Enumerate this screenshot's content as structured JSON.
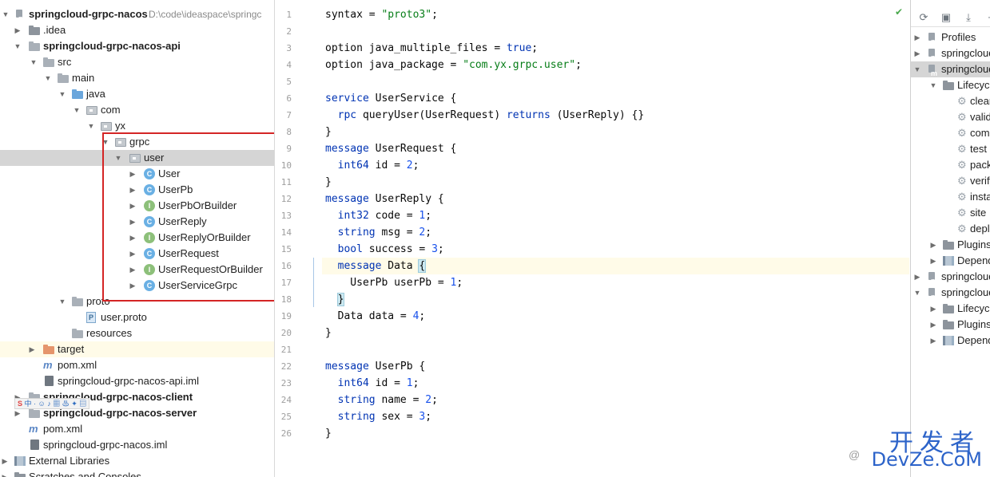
{
  "project_tree": {
    "root": {
      "label": "springcloud-grpc-nacos",
      "path": "D:\\code\\ideaspace\\springc"
    },
    "idea": ".idea",
    "api_module": "springcloud-grpc-nacos-api",
    "src": "src",
    "main": "main",
    "java": "java",
    "com": "com",
    "yx": "yx",
    "grpc": "grpc",
    "user": "user",
    "classes": [
      {
        "label": "User",
        "kind": "C"
      },
      {
        "label": "UserPb",
        "kind": "C"
      },
      {
        "label": "UserPbOrBuilder",
        "kind": "I"
      },
      {
        "label": "UserReply",
        "kind": "C"
      },
      {
        "label": "UserReplyOrBuilder",
        "kind": "I"
      },
      {
        "label": "UserRequest",
        "kind": "C"
      },
      {
        "label": "UserRequestOrBuilder",
        "kind": "I"
      },
      {
        "label": "UserServiceGrpc",
        "kind": "C"
      }
    ],
    "proto_dir": "proto",
    "proto_file": "user.proto",
    "proto_icon": "P",
    "resources": "resources",
    "target": "target",
    "api_pom": "pom.xml",
    "api_iml": "springcloud-grpc-nacos-api.iml",
    "client_module": "springcloud-grpc-nacos-client",
    "server_module": "springcloud-grpc-nacos-server",
    "root_pom": "pom.xml",
    "root_iml": "springcloud-grpc-nacos.iml",
    "external_libraries": "External Libraries",
    "scratches": "Scratches and Consoles"
  },
  "ime_toolbar": {
    "logo": "S",
    "text": "中 · ☺ ♪ ▦ ♨ ✦ ▤"
  },
  "editor": {
    "lines": [
      {
        "n": "1",
        "tokens": [
          {
            "t": "syntax = ",
            "c": ""
          },
          {
            "t": "\"proto3\"",
            "c": "str"
          },
          {
            "t": ";",
            "c": ""
          }
        ]
      },
      {
        "n": "2",
        "tokens": []
      },
      {
        "n": "3",
        "tokens": [
          {
            "t": "option java_multiple_files = ",
            "c": ""
          },
          {
            "t": "true",
            "c": "kw"
          },
          {
            "t": ";",
            "c": ""
          }
        ]
      },
      {
        "n": "4",
        "tokens": [
          {
            "t": "option java_package = ",
            "c": ""
          },
          {
            "t": "\"com.yx.grpc.user\"",
            "c": "str"
          },
          {
            "t": ";",
            "c": ""
          }
        ]
      },
      {
        "n": "5",
        "tokens": []
      },
      {
        "n": "6",
        "tokens": [
          {
            "t": "service",
            "c": "kw"
          },
          {
            "t": " UserService {",
            "c": ""
          }
        ]
      },
      {
        "n": "7",
        "tokens": [
          {
            "t": "  ",
            "c": ""
          },
          {
            "t": "rpc",
            "c": "kw"
          },
          {
            "t": " queryUser(UserRequest) ",
            "c": ""
          },
          {
            "t": "returns",
            "c": "kw"
          },
          {
            "t": " (UserReply) {}",
            "c": ""
          }
        ]
      },
      {
        "n": "8",
        "tokens": [
          {
            "t": "}",
            "c": ""
          }
        ]
      },
      {
        "n": "9",
        "tokens": [
          {
            "t": "message",
            "c": "kw"
          },
          {
            "t": " UserRequest {",
            "c": ""
          }
        ]
      },
      {
        "n": "10",
        "tokens": [
          {
            "t": "  ",
            "c": ""
          },
          {
            "t": "int64",
            "c": "kw"
          },
          {
            "t": " id = ",
            "c": ""
          },
          {
            "t": "2",
            "c": "num"
          },
          {
            "t": ";",
            "c": ""
          }
        ]
      },
      {
        "n": "11",
        "tokens": [
          {
            "t": "}",
            "c": ""
          }
        ]
      },
      {
        "n": "12",
        "tokens": [
          {
            "t": "message",
            "c": "kw"
          },
          {
            "t": " UserReply {",
            "c": ""
          }
        ]
      },
      {
        "n": "13",
        "tokens": [
          {
            "t": "  ",
            "c": ""
          },
          {
            "t": "int32",
            "c": "kw"
          },
          {
            "t": " code = ",
            "c": ""
          },
          {
            "t": "1",
            "c": "num"
          },
          {
            "t": ";",
            "c": ""
          }
        ]
      },
      {
        "n": "14",
        "tokens": [
          {
            "t": "  ",
            "c": ""
          },
          {
            "t": "string",
            "c": "kw"
          },
          {
            "t": " msg = ",
            "c": ""
          },
          {
            "t": "2",
            "c": "num"
          },
          {
            "t": ";",
            "c": ""
          }
        ]
      },
      {
        "n": "15",
        "tokens": [
          {
            "t": "  ",
            "c": ""
          },
          {
            "t": "bool",
            "c": "kw"
          },
          {
            "t": " success = ",
            "c": ""
          },
          {
            "t": "3",
            "c": "num"
          },
          {
            "t": ";",
            "c": ""
          }
        ]
      },
      {
        "n": "16",
        "tokens": [
          {
            "t": "  ",
            "c": ""
          },
          {
            "t": "message",
            "c": "kw"
          },
          {
            "t": " Data ",
            "c": ""
          },
          {
            "t": "{",
            "c": "brace"
          },
          {
            "t": "",
            "c": "caret"
          }
        ]
      },
      {
        "n": "17",
        "tokens": [
          {
            "t": "    UserPb userPb = ",
            "c": ""
          },
          {
            "t": "1",
            "c": "num"
          },
          {
            "t": ";",
            "c": ""
          }
        ]
      },
      {
        "n": "18",
        "tokens": [
          {
            "t": "  ",
            "c": ""
          },
          {
            "t": "}",
            "c": "brace"
          }
        ]
      },
      {
        "n": "19",
        "tokens": [
          {
            "t": "  Data data = ",
            "c": ""
          },
          {
            "t": "4",
            "c": "num"
          },
          {
            "t": ";",
            "c": ""
          }
        ]
      },
      {
        "n": "20",
        "tokens": [
          {
            "t": "}",
            "c": ""
          }
        ]
      },
      {
        "n": "21",
        "tokens": []
      },
      {
        "n": "22",
        "tokens": [
          {
            "t": "message",
            "c": "kw"
          },
          {
            "t": " UserPb {",
            "c": ""
          }
        ]
      },
      {
        "n": "23",
        "tokens": [
          {
            "t": "  ",
            "c": ""
          },
          {
            "t": "int64",
            "c": "kw"
          },
          {
            "t": " id = ",
            "c": ""
          },
          {
            "t": "1",
            "c": "num"
          },
          {
            "t": ";",
            "c": ""
          }
        ]
      },
      {
        "n": "24",
        "tokens": [
          {
            "t": "  ",
            "c": ""
          },
          {
            "t": "string",
            "c": "kw"
          },
          {
            "t": " name = ",
            "c": ""
          },
          {
            "t": "2",
            "c": "num"
          },
          {
            "t": ";",
            "c": ""
          }
        ]
      },
      {
        "n": "25",
        "tokens": [
          {
            "t": "  ",
            "c": ""
          },
          {
            "t": "string",
            "c": "kw"
          },
          {
            "t": " sex = ",
            "c": ""
          },
          {
            "t": "3",
            "c": "num"
          },
          {
            "t": ";",
            "c": ""
          }
        ]
      },
      {
        "n": "26",
        "tokens": [
          {
            "t": "}",
            "c": ""
          }
        ]
      }
    ],
    "current_line": "16"
  },
  "maven": {
    "toolbar": [
      {
        "icon": "refresh-icon",
        "glyph": "⟳"
      },
      {
        "icon": "add-maven-project-icon",
        "glyph": "▣"
      },
      {
        "icon": "download-icon",
        "glyph": "⤓"
      },
      {
        "icon": "add-icon",
        "glyph": "+"
      }
    ],
    "items": [
      {
        "label": "Profiles",
        "icon": "mvn"
      },
      {
        "label": "springcloud",
        "icon": "mvn"
      },
      {
        "label": "springcloud",
        "icon": "mvn",
        "selected": true
      },
      {
        "label": "Lifecycle",
        "icon": "folder"
      },
      {
        "label": "clean",
        "icon": "gear"
      },
      {
        "label": "validate",
        "icon": "gear"
      },
      {
        "label": "compile",
        "icon": "gear"
      },
      {
        "label": "test",
        "icon": "gear"
      },
      {
        "label": "package",
        "icon": "gear"
      },
      {
        "label": "verify",
        "icon": "gear"
      },
      {
        "label": "install",
        "icon": "gear"
      },
      {
        "label": "site",
        "icon": "gear"
      },
      {
        "label": "deploy",
        "icon": "gear"
      },
      {
        "label": "Plugins",
        "icon": "folder"
      },
      {
        "label": "Dependencies",
        "icon": "libs"
      },
      {
        "label": "springcloud",
        "icon": "mvn"
      },
      {
        "label": "springcloud",
        "icon": "mvn"
      },
      {
        "label": "Lifecycle",
        "icon": "folder"
      },
      {
        "label": "Plugins",
        "icon": "folder"
      },
      {
        "label": "Dependencies",
        "icon": "libs"
      }
    ]
  },
  "watermark": {
    "cn": "开发者",
    "en": "DevZe.CoM",
    "at": "@"
  },
  "colors": {
    "keyword": "#0033b3",
    "string": "#067d17",
    "number": "#1750eb",
    "selection": "#d5d5d5",
    "annotation_box": "#d42525"
  }
}
